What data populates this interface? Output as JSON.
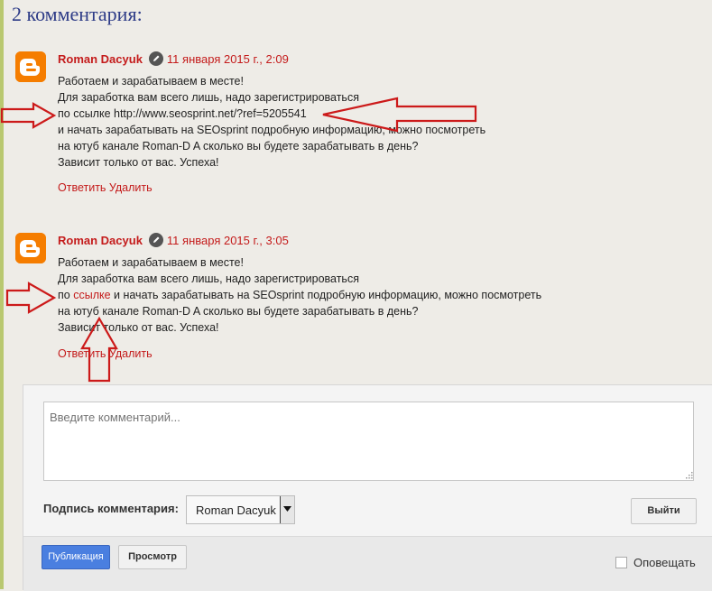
{
  "heading": "2 комментария:",
  "comments": [
    {
      "author": "Roman Dacyuk",
      "date": "11 января 2015 г., 2:09",
      "lines": [
        "Работаем и зарабатываем в месте!",
        "Для заработка вам всего лишь, надо зарегистрироваться",
        "по ссылке http://www.seosprint.net/?ref=5205541",
        "и начать зарабатывать на SEOsprint подробную информацию, можно посмотреть",
        "на ютуб канале Roman-D A сколько вы будете зарабатывать в день?",
        "Зависит только от вас. Успеха!"
      ],
      "reply_label": "Ответить",
      "delete_label": "Удалить"
    },
    {
      "author": "Roman Dacyuk",
      "date": "11 января 2015 г., 3:05",
      "lines": [
        "Работаем и зарабатываем в месте!",
        "Для заработка вам всего лишь, надо зарегистрироваться"
      ],
      "line3_prefix": "по ",
      "line3_link": "ссылке",
      "line3_suffix": " и начать зарабатывать на SEOsprint подробную информацию, можно посмотреть",
      "lines_after": [
        "на ютуб канале Roman-D A сколько вы будете зарабатывать в день?",
        "Зависит только от вас. Успеха!"
      ],
      "reply_label": "Ответить",
      "delete_label": "Удалить"
    }
  ],
  "form": {
    "placeholder": "Введите комментарий...",
    "signature_label": "Подпись комментария:",
    "signature_value": "Roman Dacyuk",
    "logout_label": "Выйти",
    "publish_label": "Публикация",
    "preview_label": "Просмотр",
    "notify_label": "Оповещать"
  },
  "colors": {
    "accent_red": "#c41b1b",
    "heading_blue": "#2d3b87",
    "blogger_orange": "#f57d00",
    "annotation_red": "#cc1a1a",
    "publish_blue": "#4a7fe0"
  },
  "icons": [
    "blogger-icon",
    "pencil-icon",
    "dropdown-arrow-icon",
    "resize-grip-icon",
    "arrow-annotation"
  ]
}
